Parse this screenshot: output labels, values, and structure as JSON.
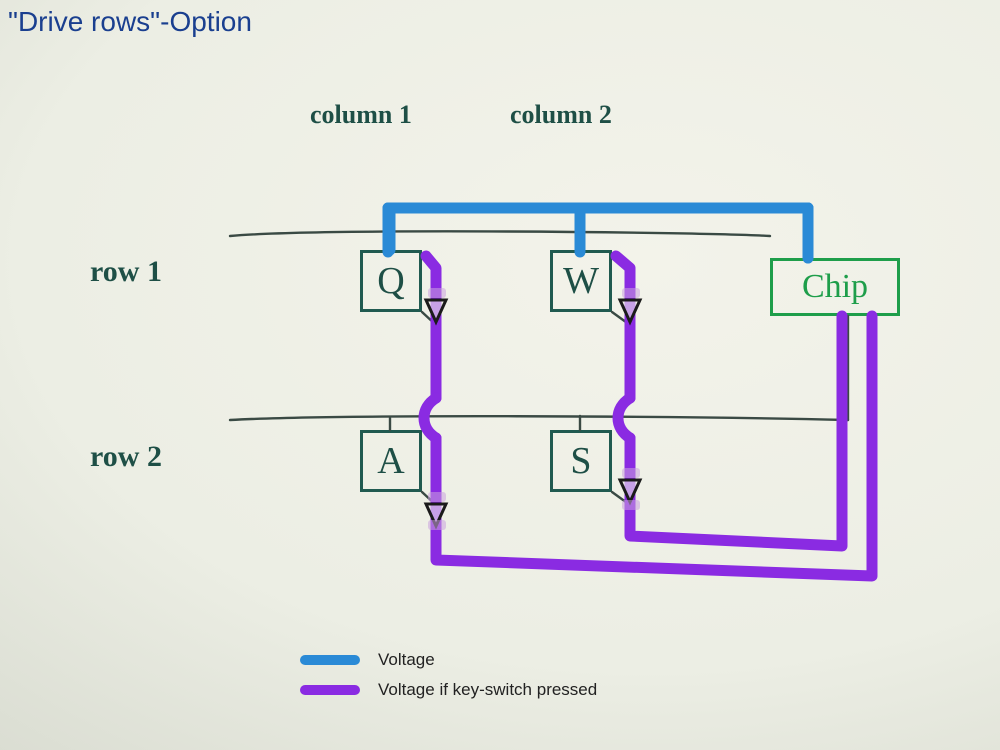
{
  "title": "\"Drive rows\"-Option",
  "columns": {
    "col1": "column 1",
    "col2": "column 2"
  },
  "rows": {
    "row1": "row 1",
    "row2": "row 2"
  },
  "keys": {
    "q": "Q",
    "w": "W",
    "a": "A",
    "s": "S"
  },
  "chip": "Chip",
  "legend": {
    "voltage": "Voltage",
    "voltage_pressed": "Voltage if key-switch pressed"
  },
  "colors": {
    "voltage": "#2a8ad6",
    "voltage_pressed": "#8a2be2",
    "pen": "#1e4f46",
    "pen_wire": "#3a4a44",
    "chip_green": "#1e9e4a",
    "title_blue": "#1a3f8f"
  },
  "chart_data": {
    "type": "table",
    "title": "Keyboard matrix — \"Drive rows\" option",
    "categories": [
      "column 1",
      "column 2"
    ],
    "series": [
      {
        "name": "row 1",
        "values": [
          "Q",
          "W"
        ]
      },
      {
        "name": "row 2",
        "values": [
          "A",
          "S"
        ]
      }
    ],
    "controller": "Chip",
    "signals": {
      "drive_voltage_on": "row 1",
      "voltage_if_key_pressed": [
        "column 1",
        "column 2"
      ]
    },
    "diodes": {
      "orientation": "key → column (downward)",
      "locations": [
        "Q→col1",
        "W→col2",
        "A→col1",
        "S→col2"
      ]
    },
    "xlabel": "columns",
    "ylabel": "rows"
  }
}
